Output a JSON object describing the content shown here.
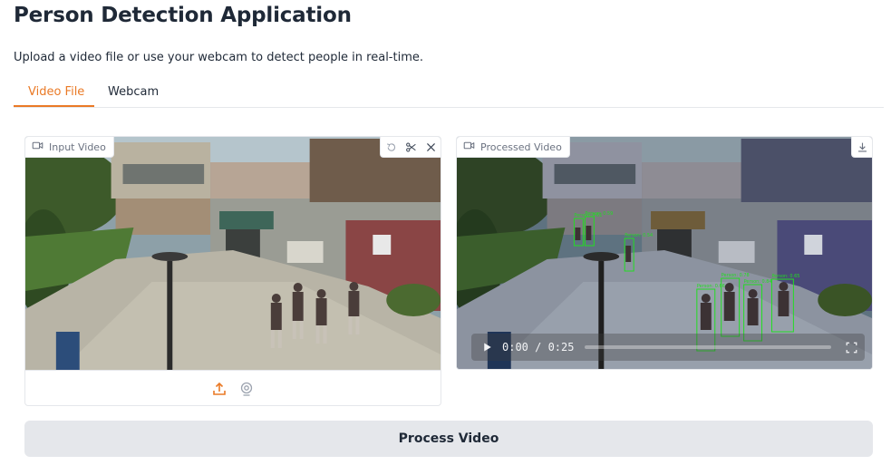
{
  "app": {
    "title": "Person Detection Application",
    "subtitle": "Upload a video file or use your webcam to detect people in real-time."
  },
  "tabs": [
    {
      "label": "Video File",
      "active": true
    },
    {
      "label": "Webcam",
      "active": false
    }
  ],
  "input_panel": {
    "label": "Input Video",
    "label_icon": "video-camera-icon",
    "tools": [
      "undo-icon",
      "scissors-icon",
      "close-icon"
    ],
    "source_buttons": [
      "upload-icon",
      "webcam-icon"
    ]
  },
  "output_panel": {
    "label": "Processed Video",
    "label_icon": "video-camera-icon",
    "tools": [
      "download-icon"
    ],
    "player": {
      "time": "0:00 / 0:25",
      "progress": 0
    },
    "detections": [
      {
        "label": "Person: 0.61"
      },
      {
        "label": "Person: 0.59"
      },
      {
        "label": "Person: 0.54"
      },
      {
        "label": "Person: 0.66"
      },
      {
        "label": "Person: 0.78"
      },
      {
        "label": "Person: 0.84"
      },
      {
        "label": "Person: 0.65"
      }
    ]
  },
  "actions": {
    "process_label": "Process Video"
  },
  "colors": {
    "accent": "#ea7a26",
    "detection_box": "#22dd22",
    "button_bg": "#e5e7eb"
  }
}
